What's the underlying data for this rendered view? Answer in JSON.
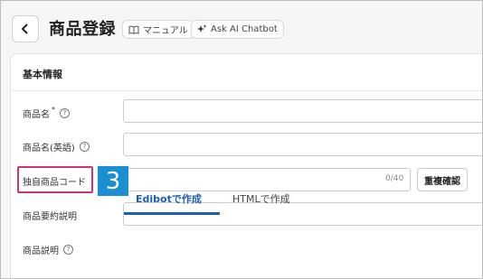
{
  "header": {
    "title": "商品登録",
    "manual_label": "マニュアル",
    "ai_label": "Ask AI Chatbot"
  },
  "section": {
    "title": "基本情報"
  },
  "fields": {
    "name_label": "商品名",
    "name_required": "*",
    "name_en_label": "商品名(英語)",
    "unique_code_label": "独自商品コード",
    "unique_code_counter": "0/40",
    "duplicate_check_label": "重複確認",
    "summary_label": "商品要約説明",
    "description_label": "商品説明"
  },
  "annotation": {
    "step_number": "3"
  },
  "tabs": [
    {
      "label": "Edibotで作成",
      "active": true
    },
    {
      "label": "HTMLで作成",
      "active": false
    }
  ],
  "colors": {
    "accent": "#1a5fb4",
    "highlight": "#d1317a",
    "badge": "#1b8fd2"
  }
}
